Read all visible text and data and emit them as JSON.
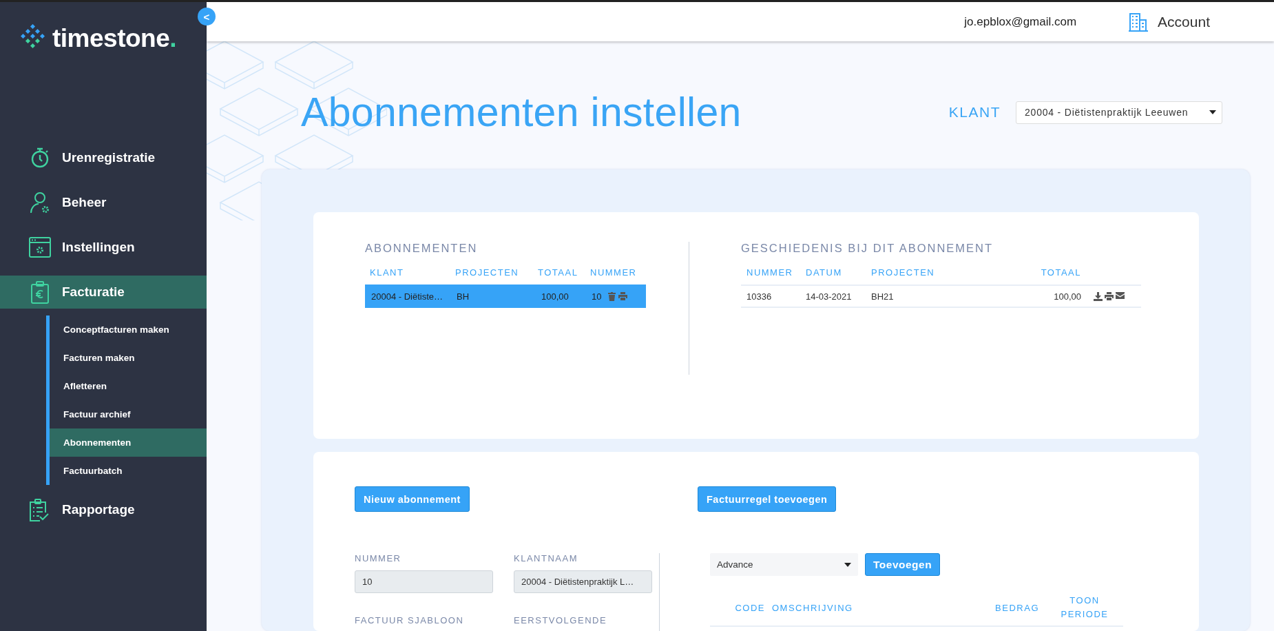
{
  "sidebar": {
    "collapse_button": "<",
    "logo": {
      "name": "timestone",
      "mark": "."
    },
    "items": [
      {
        "label": "Urenregistratie",
        "selected": false,
        "expanded": false
      },
      {
        "label": "Beheer",
        "selected": false,
        "expanded": false
      },
      {
        "label": "Instellingen",
        "selected": false,
        "expanded": false
      },
      {
        "label": "Facturatie",
        "selected": true,
        "expanded": true,
        "children": [
          {
            "label": "Conceptfacturen maken",
            "selected": false
          },
          {
            "label": "Facturen maken",
            "selected": false
          },
          {
            "label": "Afletteren",
            "selected": false
          },
          {
            "label": "Factuur archief",
            "selected": false
          },
          {
            "label": "Abonnementen",
            "selected": true
          },
          {
            "label": "Factuurbatch",
            "selected": false
          }
        ]
      },
      {
        "label": "Rapportage",
        "selected": false,
        "expanded": false
      }
    ]
  },
  "header": {
    "email": "jo.epblox@gmail.com",
    "account": "Account"
  },
  "page": {
    "title": "Abonnementen instellen",
    "client_label": "KLANT",
    "client_select": "20004 - Diëtistenpraktijk Leeuwen"
  },
  "subscriptions": {
    "title": "ABONNEMENTEN",
    "columns": [
      "KLANT",
      "PROJECTEN",
      "TOTAAL",
      "NUMMER"
    ],
    "rows": [
      {
        "cells": [
          "20004 - Diëtiste…",
          "BH",
          "100,00",
          "10"
        ],
        "selected": true
      }
    ]
  },
  "history": {
    "title": "GESCHIEDENIS BIJ DIT ABONNEMENT",
    "columns": [
      "NUMMER",
      "DATUM",
      "PROJECTEN",
      "TOTAAL"
    ],
    "rows": [
      {
        "cells": [
          "10336",
          "14-03-2021",
          "BH21",
          "100,00"
        ]
      }
    ]
  },
  "form": {
    "new_button": "Nieuw abonnement",
    "line_button": "Factuurregel toevoegen",
    "fields": [
      {
        "label": "NUMMER",
        "value": "10",
        "disabled": true
      },
      {
        "label": "KLANTNAAM",
        "value": "20004 - Diëtistenpraktijk L…",
        "disabled": true
      }
    ],
    "more_labels": [
      "FACTUUR SJABLOON",
      "EERSTVOLGENDE"
    ],
    "line_select": "Advance",
    "add_button": "Toevoegen",
    "line_columns": [
      "CODE",
      "OMSCHRIJVING",
      "BEDRAG",
      "TOON PERIODE"
    ]
  }
}
